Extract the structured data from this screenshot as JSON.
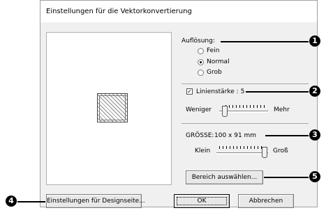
{
  "dialog": {
    "title": "Einstellungen für die Vektorkonvertierung"
  },
  "resolution": {
    "label": "Auflösung:",
    "options": [
      {
        "label": "Fein",
        "selected": false
      },
      {
        "label": "Normal",
        "selected": true
      },
      {
        "label": "Grob",
        "selected": false
      }
    ]
  },
  "line_thickness": {
    "label": "Linienstärke : 5",
    "checked": true,
    "min_label": "Weniger",
    "max_label": "Mehr"
  },
  "size": {
    "label": "GRÖSSE:",
    "value": "100 x 91 mm",
    "min_label": "Klein",
    "max_label": "Groß"
  },
  "buttons": {
    "select_area": "Bereich auswählen...",
    "design_page": "Einstellungen für Designseite...",
    "ok": "OK",
    "cancel": "Abbrechen"
  },
  "callouts": [
    "1",
    "2",
    "3",
    "4",
    "5"
  ],
  "colors": {
    "dialog_bg": "#f0f0f0",
    "callout": "#000000"
  }
}
